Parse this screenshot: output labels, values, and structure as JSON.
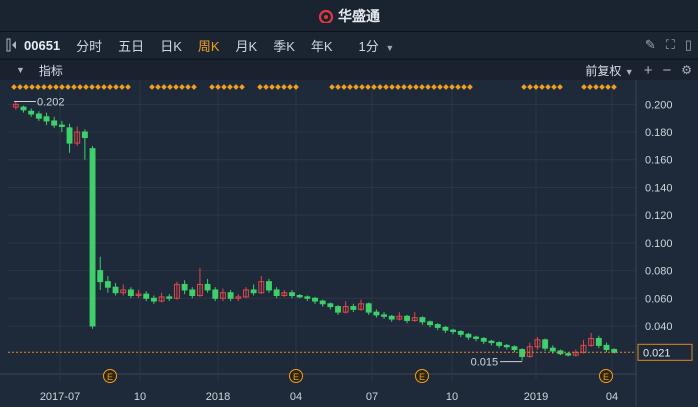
{
  "app": {
    "title": "华盛通"
  },
  "toolbar": {
    "ticker": "00651",
    "tabs": [
      "分时",
      "五日",
      "日K",
      "周K",
      "月K",
      "季K",
      "年K"
    ],
    "active_tab": "周K",
    "interval": "1分"
  },
  "indicator_bar": {
    "label": "指标",
    "adjust": "前复权"
  },
  "chart_data": {
    "type": "candlestick",
    "ylim": [
      0.014,
      0.206
    ],
    "y_ticks": [
      "0.200",
      "0.180",
      "0.160",
      "0.140",
      "0.120",
      "0.100",
      "0.080",
      "0.060",
      "0.040",
      "0.021"
    ],
    "x_ticks": [
      "2017-07",
      "10",
      "2018",
      "04",
      "07",
      "10",
      "2019",
      "04"
    ],
    "annotations": {
      "max": "0.202",
      "min": "0.015",
      "last": "0.021"
    },
    "event_marker": "E",
    "colors": {
      "up": "#e0474c",
      "down": "#3fcf6b",
      "marker": "#f0a020",
      "last_line": "#e08a20"
    },
    "candles": [
      [
        0.198,
        0.2,
        0.202,
        0.196
      ],
      [
        0.198,
        0.196,
        0.199,
        0.194
      ],
      [
        0.195,
        0.193,
        0.197,
        0.191
      ],
      [
        0.193,
        0.19,
        0.195,
        0.188
      ],
      [
        0.191,
        0.188,
        0.194,
        0.185
      ],
      [
        0.188,
        0.185,
        0.191,
        0.183
      ],
      [
        0.185,
        0.184,
        0.188,
        0.18
      ],
      [
        0.183,
        0.172,
        0.186,
        0.165
      ],
      [
        0.172,
        0.18,
        0.184,
        0.17
      ],
      [
        0.18,
        0.176,
        0.182,
        0.16
      ],
      [
        0.168,
        0.04,
        0.17,
        0.038
      ],
      [
        0.08,
        0.072,
        0.09,
        0.066
      ],
      [
        0.072,
        0.068,
        0.076,
        0.064
      ],
      [
        0.068,
        0.064,
        0.071,
        0.062
      ],
      [
        0.064,
        0.066,
        0.07,
        0.062
      ],
      [
        0.066,
        0.062,
        0.068,
        0.06
      ],
      [
        0.062,
        0.063,
        0.066,
        0.06
      ],
      [
        0.063,
        0.06,
        0.065,
        0.058
      ],
      [
        0.06,
        0.058,
        0.062,
        0.056
      ],
      [
        0.058,
        0.061,
        0.064,
        0.057
      ],
      [
        0.061,
        0.06,
        0.063,
        0.058
      ],
      [
        0.06,
        0.07,
        0.072,
        0.059
      ],
      [
        0.07,
        0.066,
        0.073,
        0.063
      ],
      [
        0.066,
        0.062,
        0.068,
        0.06
      ],
      [
        0.062,
        0.07,
        0.082,
        0.061
      ],
      [
        0.07,
        0.066,
        0.074,
        0.064
      ],
      [
        0.066,
        0.06,
        0.068,
        0.058
      ],
      [
        0.06,
        0.064,
        0.067,
        0.058
      ],
      [
        0.064,
        0.06,
        0.066,
        0.058
      ],
      [
        0.06,
        0.061,
        0.063,
        0.058
      ],
      [
        0.061,
        0.066,
        0.068,
        0.06
      ],
      [
        0.066,
        0.064,
        0.07,
        0.062
      ],
      [
        0.064,
        0.072,
        0.076,
        0.063
      ],
      [
        0.072,
        0.066,
        0.074,
        0.064
      ],
      [
        0.066,
        0.062,
        0.068,
        0.06
      ],
      [
        0.062,
        0.064,
        0.066,
        0.061
      ],
      [
        0.064,
        0.062,
        0.066,
        0.06
      ],
      [
        0.062,
        0.061,
        0.063,
        0.06
      ],
      [
        0.061,
        0.06,
        0.062,
        0.058
      ],
      [
        0.06,
        0.058,
        0.061,
        0.056
      ],
      [
        0.058,
        0.056,
        0.059,
        0.054
      ],
      [
        0.056,
        0.054,
        0.057,
        0.052
      ],
      [
        0.054,
        0.05,
        0.055,
        0.048
      ],
      [
        0.05,
        0.054,
        0.058,
        0.049
      ],
      [
        0.054,
        0.052,
        0.056,
        0.05
      ],
      [
        0.052,
        0.056,
        0.059,
        0.051
      ],
      [
        0.056,
        0.05,
        0.057,
        0.048
      ],
      [
        0.05,
        0.048,
        0.052,
        0.046
      ],
      [
        0.048,
        0.047,
        0.05,
        0.045
      ],
      [
        0.047,
        0.045,
        0.048,
        0.043
      ],
      [
        0.045,
        0.047,
        0.05,
        0.044
      ],
      [
        0.047,
        0.044,
        0.048,
        0.042
      ],
      [
        0.044,
        0.046,
        0.05,
        0.043
      ],
      [
        0.046,
        0.043,
        0.047,
        0.041
      ],
      [
        0.043,
        0.041,
        0.044,
        0.039
      ],
      [
        0.041,
        0.039,
        0.042,
        0.037
      ],
      [
        0.039,
        0.037,
        0.04,
        0.035
      ],
      [
        0.037,
        0.036,
        0.038,
        0.034
      ],
      [
        0.036,
        0.034,
        0.037,
        0.032
      ],
      [
        0.034,
        0.032,
        0.035,
        0.03
      ],
      [
        0.032,
        0.031,
        0.033,
        0.029
      ],
      [
        0.031,
        0.029,
        0.032,
        0.027
      ],
      [
        0.029,
        0.028,
        0.03,
        0.026
      ],
      [
        0.028,
        0.026,
        0.029,
        0.024
      ],
      [
        0.026,
        0.025,
        0.027,
        0.023
      ],
      [
        0.025,
        0.023,
        0.026,
        0.021
      ],
      [
        0.023,
        0.018,
        0.024,
        0.015
      ],
      [
        0.018,
        0.025,
        0.028,
        0.017
      ],
      [
        0.025,
        0.03,
        0.032,
        0.023
      ],
      [
        0.03,
        0.024,
        0.031,
        0.022
      ],
      [
        0.024,
        0.022,
        0.026,
        0.02
      ],
      [
        0.022,
        0.02,
        0.023,
        0.019
      ],
      [
        0.02,
        0.019,
        0.021,
        0.018
      ],
      [
        0.019,
        0.021,
        0.023,
        0.018
      ],
      [
        0.021,
        0.026,
        0.03,
        0.02
      ],
      [
        0.026,
        0.031,
        0.035,
        0.025
      ],
      [
        0.031,
        0.026,
        0.033,
        0.024
      ],
      [
        0.026,
        0.023,
        0.028,
        0.021
      ],
      [
        0.023,
        0.021,
        0.024,
        0.02
      ]
    ]
  }
}
